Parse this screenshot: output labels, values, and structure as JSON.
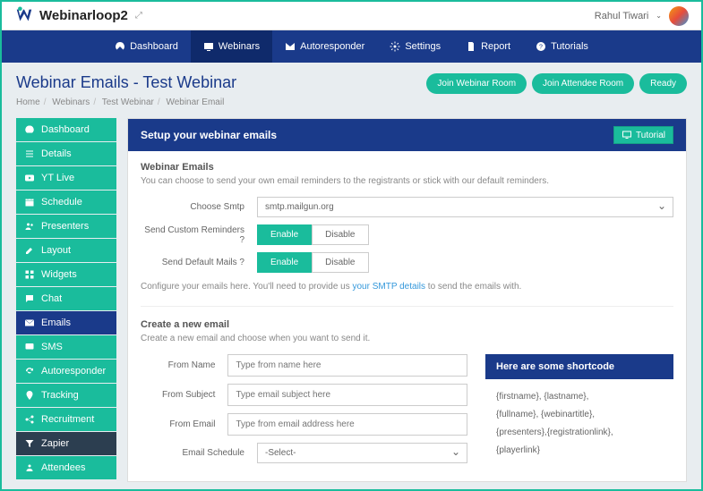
{
  "brand": "Webinarloop2",
  "user": {
    "name": "Rahul Tiwari"
  },
  "nav": {
    "dashboard": "Dashboard",
    "webinars": "Webinars",
    "autoresponder": "Autoresponder",
    "settings": "Settings",
    "report": "Report",
    "tutorials": "Tutorials"
  },
  "page": {
    "title": "Webinar Emails - Test Webinar",
    "crumbs": {
      "home": "Home",
      "webinars": "Webinars",
      "test": "Test Webinar",
      "current": "Webinar Email"
    },
    "actions": {
      "join_room": "Join Webinar Room",
      "join_attendee": "Join Attendee Room",
      "ready": "Ready"
    }
  },
  "sidebar": {
    "dashboard": "Dashboard",
    "details": "Details",
    "ytlive": "YT Live",
    "schedule": "Schedule",
    "presenters": "Presenters",
    "layout": "Layout",
    "widgets": "Widgets",
    "chat": "Chat",
    "emails": "Emails",
    "sms": "SMS",
    "autoresponder": "Autoresponder",
    "tracking": "Tracking",
    "recruitment": "Recruitment",
    "zapier": "Zapier",
    "attendees": "Attendees"
  },
  "main": {
    "title": "Setup your webinar emails",
    "tutorial": "Tutorial",
    "section1": {
      "title": "Webinar Emails",
      "desc": "You can choose to send your own email reminders to the registrants or stick with our default reminders.",
      "smtp_label": "Choose Smtp",
      "smtp_value": "smtp.mailgun.org",
      "custom_label": "Send Custom Reminders ?",
      "default_label": "Send Default Mails ?",
      "enable": "Enable",
      "disable": "Disable",
      "config_pre": "Configure your emails here. You'll need to provide us ",
      "config_link": "your SMTP details",
      "config_post": " to send the emails with."
    },
    "section2": {
      "title": "Create a new email",
      "desc": "Create a new email and choose when you want to send it.",
      "from_name": "From Name",
      "from_name_ph": "Type from name here",
      "from_subject": "From Subject",
      "from_subject_ph": "Type email subject here",
      "from_email": "From Email",
      "from_email_ph": "Type from email address here",
      "schedule": "Email Schedule",
      "schedule_value": "-Select-"
    },
    "shortcode": {
      "title": "Here are some shortcode",
      "line1": "{firstname},  {lastname},",
      "line2": "{fullname},  {webinartitle},",
      "line3": "{presenters},{registrationlink},",
      "line4": "{playerlink}"
    }
  }
}
